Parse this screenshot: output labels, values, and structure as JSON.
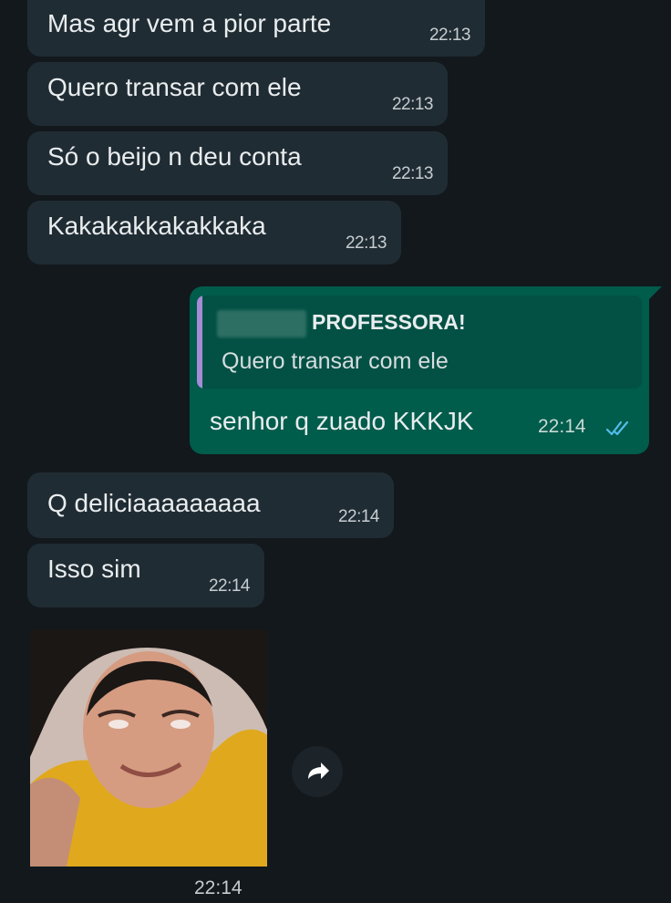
{
  "messages_in_1": [
    {
      "text": "Mas agr vem a pior parte",
      "time": "22:13"
    },
    {
      "text": "Quero transar com ele",
      "time": "22:13"
    },
    {
      "text": "Só o beijo n deu conta",
      "time": "22:13"
    },
    {
      "text": "Kakakakkakakkaka",
      "time": "22:13"
    }
  ],
  "reply": {
    "quote_author": "PROFESSORA!",
    "quote_text": "Quero transar com ele",
    "text": "senhor q zuado KKKJK",
    "time": "22:14",
    "status": "read",
    "colors": {
      "bubble": "#005c4b",
      "quote_bar": "#a78bd7",
      "ticks": "#53bdeb"
    }
  },
  "messages_in_2": [
    {
      "text": "Q deliciaaaaaaaaa",
      "time": "22:14"
    },
    {
      "text": "Isso sim",
      "time": "22:14"
    }
  ],
  "image_message": {
    "time": "22:14",
    "forward_icon": "forward-arrow-icon"
  },
  "theme": {
    "background": "#12181c",
    "incoming_bubble": "#202c33"
  }
}
